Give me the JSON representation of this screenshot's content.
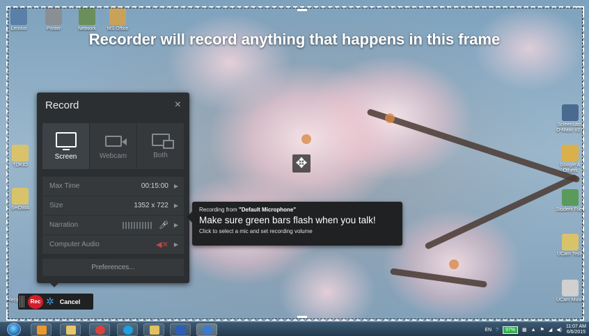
{
  "frame": {
    "message": "Recorder will record anything that happens in this frame"
  },
  "desktop": {
    "left_icons": [
      {
        "label": "Lenovo",
        "icon": "computer-icon",
        "color": "#5a7fa8"
      },
      {
        "label": "Printer",
        "icon": "printer-icon",
        "color": "#8a8f94"
      },
      {
        "label": "Network",
        "icon": "network-icon",
        "color": "#6b8f5a"
      },
      {
        "label": "MS Office",
        "icon": "office-icon",
        "color": "#c9a25a"
      },
      {
        "label": "TOKIO",
        "icon": "folder-icon",
        "color": "#d9c36a"
      },
      {
        "label": "SHOWA",
        "icon": "folder-icon",
        "color": "#d9c36a"
      },
      {
        "label": "Recycle Bin",
        "icon": "recycle-bin-icon",
        "color": "#8aa6c4"
      }
    ],
    "right_icons": [
      {
        "label": "Screencast-O-Matic v2.0",
        "icon": "screencast-icon",
        "color": "#4a6b8f"
      },
      {
        "label": "Google & Others",
        "icon": "folder-icon",
        "color": "#d9b04a"
      },
      {
        "label": "Student Files",
        "icon": "users-icon",
        "color": "#5a9a5a"
      },
      {
        "label": "UCam Tests",
        "icon": "folder-icon",
        "color": "#d9c36a"
      },
      {
        "label": "UCam Music",
        "icon": "music-icon",
        "color": "#d0d0d0"
      }
    ]
  },
  "record_panel": {
    "title": "Record",
    "close_symbol": "×",
    "modes": [
      {
        "label": "Screen",
        "icon": "monitor-icon",
        "active": true
      },
      {
        "label": "Webcam",
        "icon": "webcam-icon",
        "active": false
      },
      {
        "label": "Both",
        "icon": "screen-and-webcam-icon",
        "active": false
      }
    ],
    "settings": {
      "max_time": {
        "label": "Max Time",
        "value": "00:15:00"
      },
      "size": {
        "label": "Size",
        "value": "1352 x 722"
      },
      "narration": {
        "label": "Narration"
      },
      "computer_audio": {
        "label": "Computer Audio"
      }
    },
    "preferences_label": "Preferences..."
  },
  "tooltip": {
    "line1_prefix": "Recording from ",
    "line1_device": "\"Default Microphone\"",
    "line2": "Make sure green bars flash when you talk!",
    "line3": "Click to select a mic and set recording volume"
  },
  "rec_bar": {
    "rec_label": "Rec",
    "cancel_label": "Cancel"
  },
  "taskbar": {
    "apps": [
      {
        "icon": "media-player-icon",
        "color": "#e89a2a"
      },
      {
        "icon": "file-explorer-icon",
        "color": "#e8c66a"
      },
      {
        "icon": "chrome-icon",
        "color": "#d9433a"
      },
      {
        "icon": "skype-icon",
        "color": "#1fa0e0"
      },
      {
        "icon": "folder-icon",
        "color": "#e0c060"
      },
      {
        "icon": "word-icon",
        "color": "#2b5fb8"
      },
      {
        "icon": "screencast-icon",
        "color": "#3a7bd0"
      }
    ],
    "language": "EN",
    "battery": "97%",
    "time": "11:07 AM",
    "date": "6/6/2015"
  }
}
